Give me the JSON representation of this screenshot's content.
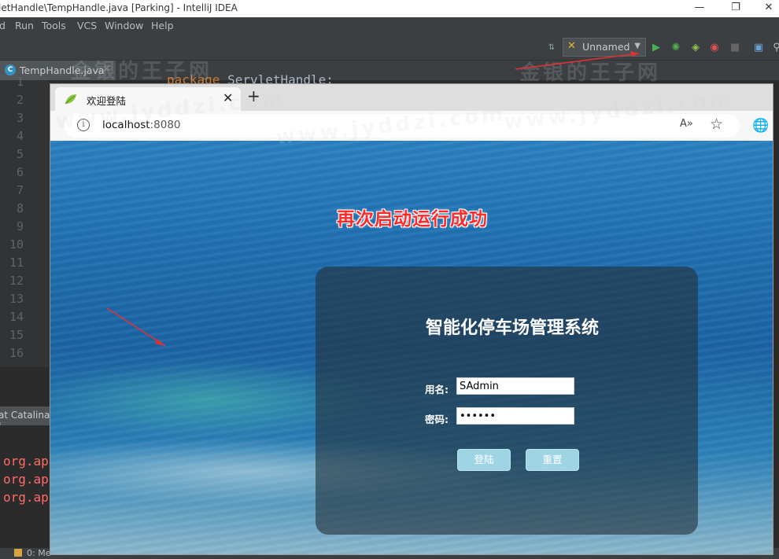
{
  "ide": {
    "window_title": "letHandle\\TempHandle.java [Parking] - IntelliJ IDEA",
    "menu": [
      "d",
      "Run",
      "Tools",
      "VCS",
      "Window",
      "Help"
    ],
    "run_config": "Unnamed",
    "editor_tab": "TempHandle.java",
    "editor_tab_badge": "C",
    "code_line": {
      "keyword": "package",
      "rest": " ServletHandle;"
    },
    "line_numbers": [
      "1",
      "2",
      "3",
      "4",
      "5",
      "6",
      "7",
      "8",
      "9",
      "10",
      "11",
      "12",
      "13",
      "14",
      "15",
      "16"
    ],
    "run_panel_tab": "at Catalina L",
    "console_lines": [
      "org.ap",
      "org.ap",
      "org.ap"
    ],
    "status_left": "0: Me"
  },
  "browser": {
    "tab_title": "欢迎登陆",
    "url_host": "localhost",
    "url_port": ":8080",
    "read_aloud": "A»"
  },
  "page": {
    "headline": "再次启动运行成功",
    "system_title": "智能化停车场管理系统",
    "username_label": "用名:",
    "username_value": "SAdmin",
    "password_label": "密码:",
    "password_value": "••••••",
    "login_button": "登陆",
    "reset_button": "重置",
    "headline_color": "#ff2a2a"
  },
  "watermarks": [
    "金银的王子网",
    "www.jyddzi.com",
    "金银的王子网",
    "www.jyddzi.com",
    "www.jyddzi.com"
  ]
}
